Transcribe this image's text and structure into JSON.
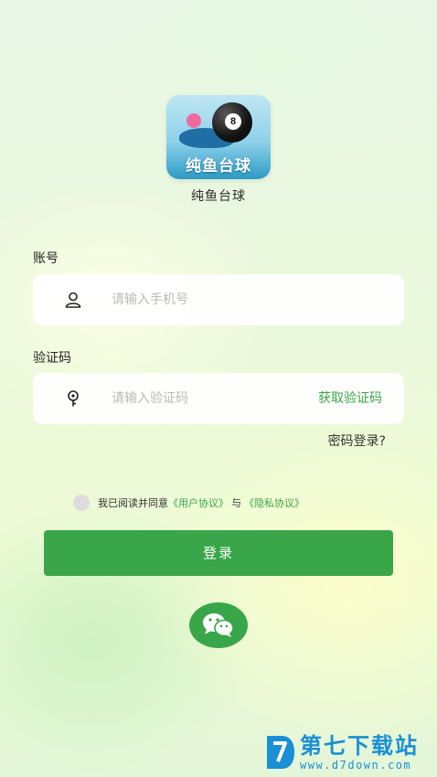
{
  "app": {
    "logo_text": "纯鱼台球",
    "logo_ball_number": "8",
    "name": "纯鱼台球"
  },
  "phone": {
    "label": "账号",
    "placeholder": "请输入手机号",
    "value": "",
    "icon": "user-icon"
  },
  "code": {
    "label": "验证码",
    "placeholder": "请输入验证码",
    "value": "",
    "icon": "key-icon",
    "get_code_label": "获取验证码"
  },
  "password_login_label": "密码登录?",
  "agreement": {
    "prefix": "我已阅读并同意",
    "user_agreement": "《用户协议》",
    "and": "与",
    "privacy_policy": "《隐私协议》",
    "checked": false
  },
  "login_button_label": "登录",
  "wechat_login": {
    "icon": "wechat-icon"
  },
  "watermark": {
    "title": "第七下载站",
    "url": "www.d7down.com"
  },
  "colors": {
    "accent": "#3aa64a",
    "watermark": "#1a8fd4"
  }
}
